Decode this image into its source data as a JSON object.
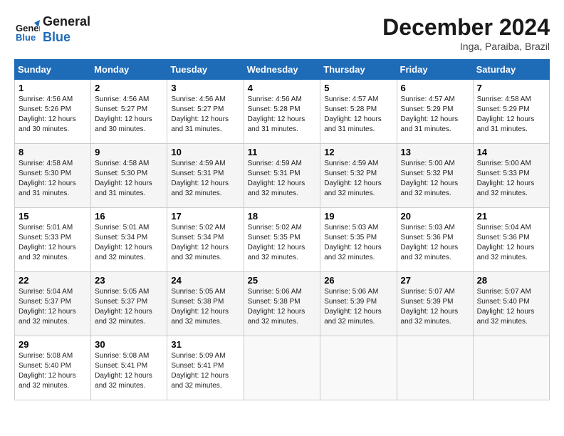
{
  "logo": {
    "line1": "General",
    "line2": "Blue"
  },
  "title": "December 2024",
  "location": "Inga, Paraiba, Brazil",
  "weekdays": [
    "Sunday",
    "Monday",
    "Tuesday",
    "Wednesday",
    "Thursday",
    "Friday",
    "Saturday"
  ],
  "weeks": [
    [
      {
        "day": "1",
        "sunrise": "4:56 AM",
        "sunset": "5:26 PM",
        "daylight": "12 hours and 30 minutes."
      },
      {
        "day": "2",
        "sunrise": "4:56 AM",
        "sunset": "5:27 PM",
        "daylight": "12 hours and 30 minutes."
      },
      {
        "day": "3",
        "sunrise": "4:56 AM",
        "sunset": "5:27 PM",
        "daylight": "12 hours and 31 minutes."
      },
      {
        "day": "4",
        "sunrise": "4:56 AM",
        "sunset": "5:28 PM",
        "daylight": "12 hours and 31 minutes."
      },
      {
        "day": "5",
        "sunrise": "4:57 AM",
        "sunset": "5:28 PM",
        "daylight": "12 hours and 31 minutes."
      },
      {
        "day": "6",
        "sunrise": "4:57 AM",
        "sunset": "5:29 PM",
        "daylight": "12 hours and 31 minutes."
      },
      {
        "day": "7",
        "sunrise": "4:58 AM",
        "sunset": "5:29 PM",
        "daylight": "12 hours and 31 minutes."
      }
    ],
    [
      {
        "day": "8",
        "sunrise": "4:58 AM",
        "sunset": "5:30 PM",
        "daylight": "12 hours and 31 minutes."
      },
      {
        "day": "9",
        "sunrise": "4:58 AM",
        "sunset": "5:30 PM",
        "daylight": "12 hours and 31 minutes."
      },
      {
        "day": "10",
        "sunrise": "4:59 AM",
        "sunset": "5:31 PM",
        "daylight": "12 hours and 32 minutes."
      },
      {
        "day": "11",
        "sunrise": "4:59 AM",
        "sunset": "5:31 PM",
        "daylight": "12 hours and 32 minutes."
      },
      {
        "day": "12",
        "sunrise": "4:59 AM",
        "sunset": "5:32 PM",
        "daylight": "12 hours and 32 minutes."
      },
      {
        "day": "13",
        "sunrise": "5:00 AM",
        "sunset": "5:32 PM",
        "daylight": "12 hours and 32 minutes."
      },
      {
        "day": "14",
        "sunrise": "5:00 AM",
        "sunset": "5:33 PM",
        "daylight": "12 hours and 32 minutes."
      }
    ],
    [
      {
        "day": "15",
        "sunrise": "5:01 AM",
        "sunset": "5:33 PM",
        "daylight": "12 hours and 32 minutes."
      },
      {
        "day": "16",
        "sunrise": "5:01 AM",
        "sunset": "5:34 PM",
        "daylight": "12 hours and 32 minutes."
      },
      {
        "day": "17",
        "sunrise": "5:02 AM",
        "sunset": "5:34 PM",
        "daylight": "12 hours and 32 minutes."
      },
      {
        "day": "18",
        "sunrise": "5:02 AM",
        "sunset": "5:35 PM",
        "daylight": "12 hours and 32 minutes."
      },
      {
        "day": "19",
        "sunrise": "5:03 AM",
        "sunset": "5:35 PM",
        "daylight": "12 hours and 32 minutes."
      },
      {
        "day": "20",
        "sunrise": "5:03 AM",
        "sunset": "5:36 PM",
        "daylight": "12 hours and 32 minutes."
      },
      {
        "day": "21",
        "sunrise": "5:04 AM",
        "sunset": "5:36 PM",
        "daylight": "12 hours and 32 minutes."
      }
    ],
    [
      {
        "day": "22",
        "sunrise": "5:04 AM",
        "sunset": "5:37 PM",
        "daylight": "12 hours and 32 minutes."
      },
      {
        "day": "23",
        "sunrise": "5:05 AM",
        "sunset": "5:37 PM",
        "daylight": "12 hours and 32 minutes."
      },
      {
        "day": "24",
        "sunrise": "5:05 AM",
        "sunset": "5:38 PM",
        "daylight": "12 hours and 32 minutes."
      },
      {
        "day": "25",
        "sunrise": "5:06 AM",
        "sunset": "5:38 PM",
        "daylight": "12 hours and 32 minutes."
      },
      {
        "day": "26",
        "sunrise": "5:06 AM",
        "sunset": "5:39 PM",
        "daylight": "12 hours and 32 minutes."
      },
      {
        "day": "27",
        "sunrise": "5:07 AM",
        "sunset": "5:39 PM",
        "daylight": "12 hours and 32 minutes."
      },
      {
        "day": "28",
        "sunrise": "5:07 AM",
        "sunset": "5:40 PM",
        "daylight": "12 hours and 32 minutes."
      }
    ],
    [
      {
        "day": "29",
        "sunrise": "5:08 AM",
        "sunset": "5:40 PM",
        "daylight": "12 hours and 32 minutes."
      },
      {
        "day": "30",
        "sunrise": "5:08 AM",
        "sunset": "5:41 PM",
        "daylight": "12 hours and 32 minutes."
      },
      {
        "day": "31",
        "sunrise": "5:09 AM",
        "sunset": "5:41 PM",
        "daylight": "12 hours and 32 minutes."
      },
      null,
      null,
      null,
      null
    ]
  ]
}
